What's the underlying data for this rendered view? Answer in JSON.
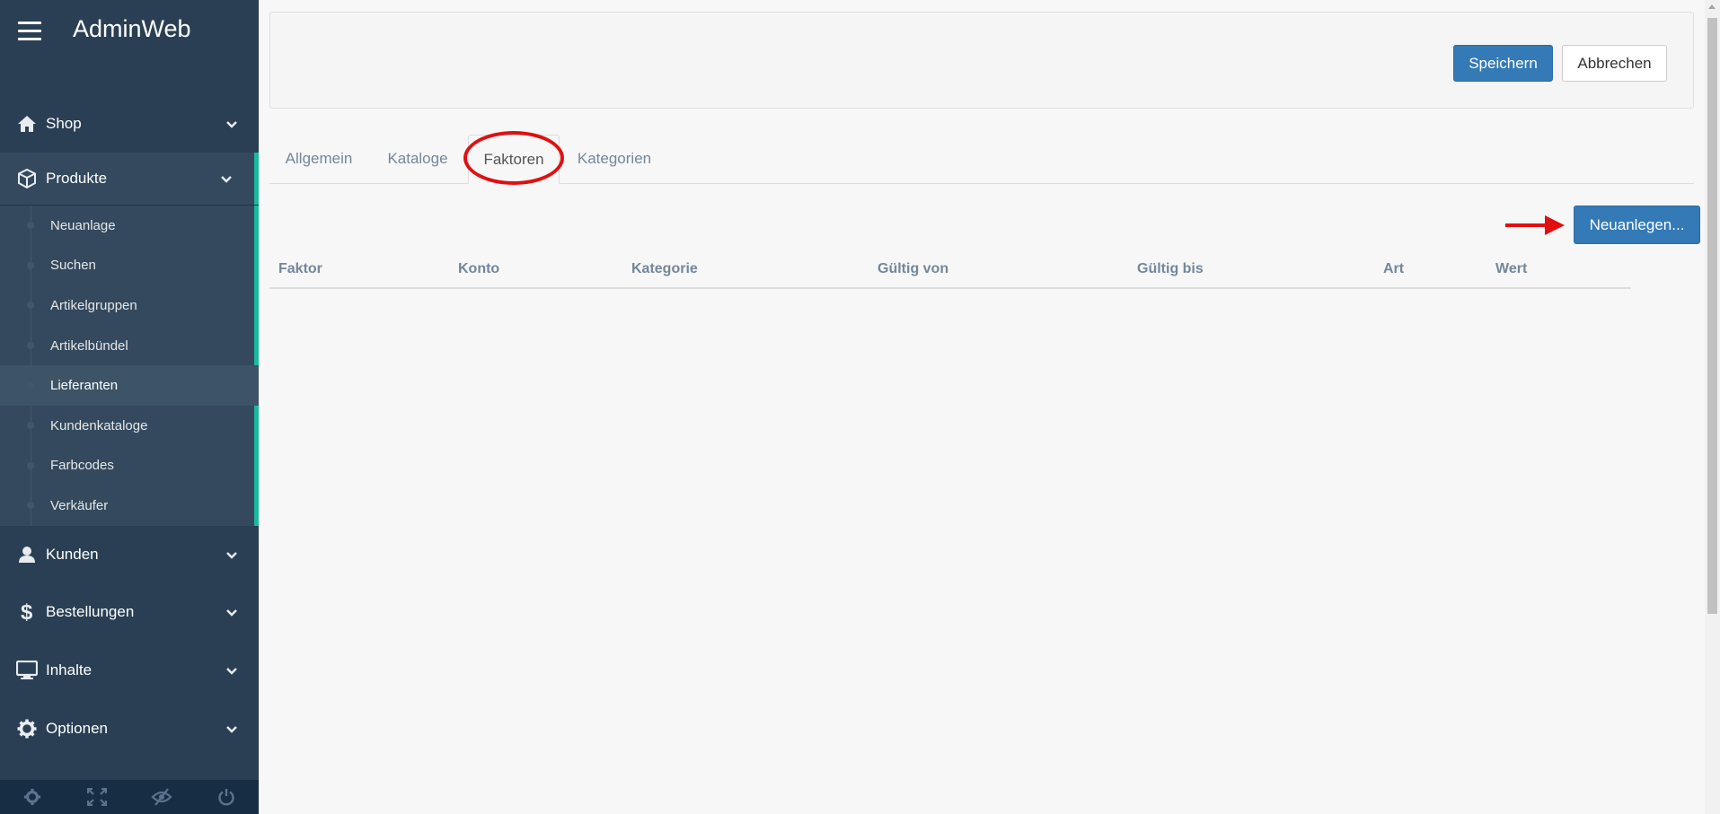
{
  "app": {
    "title": "AdminWeb"
  },
  "sidebar": {
    "menu": [
      {
        "label": "Shop",
        "icon": "home-icon"
      },
      {
        "label": "Produkte",
        "icon": "cube-icon"
      },
      {
        "label": "Kunden",
        "icon": "user-icon"
      },
      {
        "label": "Bestellungen",
        "icon": "dollar-icon"
      },
      {
        "label": "Inhalte",
        "icon": "monitor-icon"
      },
      {
        "label": "Optionen",
        "icon": "gear-icon"
      }
    ],
    "submenu": [
      {
        "label": "Neuanlage"
      },
      {
        "label": "Suchen"
      },
      {
        "label": "Artikelgruppen"
      },
      {
        "label": "Artikelbündel"
      },
      {
        "label": "Lieferanten",
        "active": true
      },
      {
        "label": "Kundenkataloge"
      },
      {
        "label": "Farbcodes"
      },
      {
        "label": "Verkäufer"
      }
    ],
    "footer_icons": [
      "settings-icon",
      "fullscreen-icon",
      "eye-slash-icon",
      "power-icon"
    ]
  },
  "toolbar": {
    "save_label": "Speichern",
    "cancel_label": "Abbrechen"
  },
  "tabs": [
    {
      "label": "Allgemein"
    },
    {
      "label": "Kataloge"
    },
    {
      "label": "Faktoren",
      "active": true
    },
    {
      "label": "Kategorien"
    }
  ],
  "new_button": {
    "label": "Neuanlegen..."
  },
  "table": {
    "columns": [
      "Faktor",
      "Konto",
      "Kategorie",
      "Gültig von",
      "Gültig bis",
      "Art",
      "Wert"
    ],
    "rows": []
  },
  "colors": {
    "sidebar_bg": "#2a3f54",
    "accent": "#1abb9c",
    "primary": "#337ab7",
    "annotation": "#e01010"
  }
}
